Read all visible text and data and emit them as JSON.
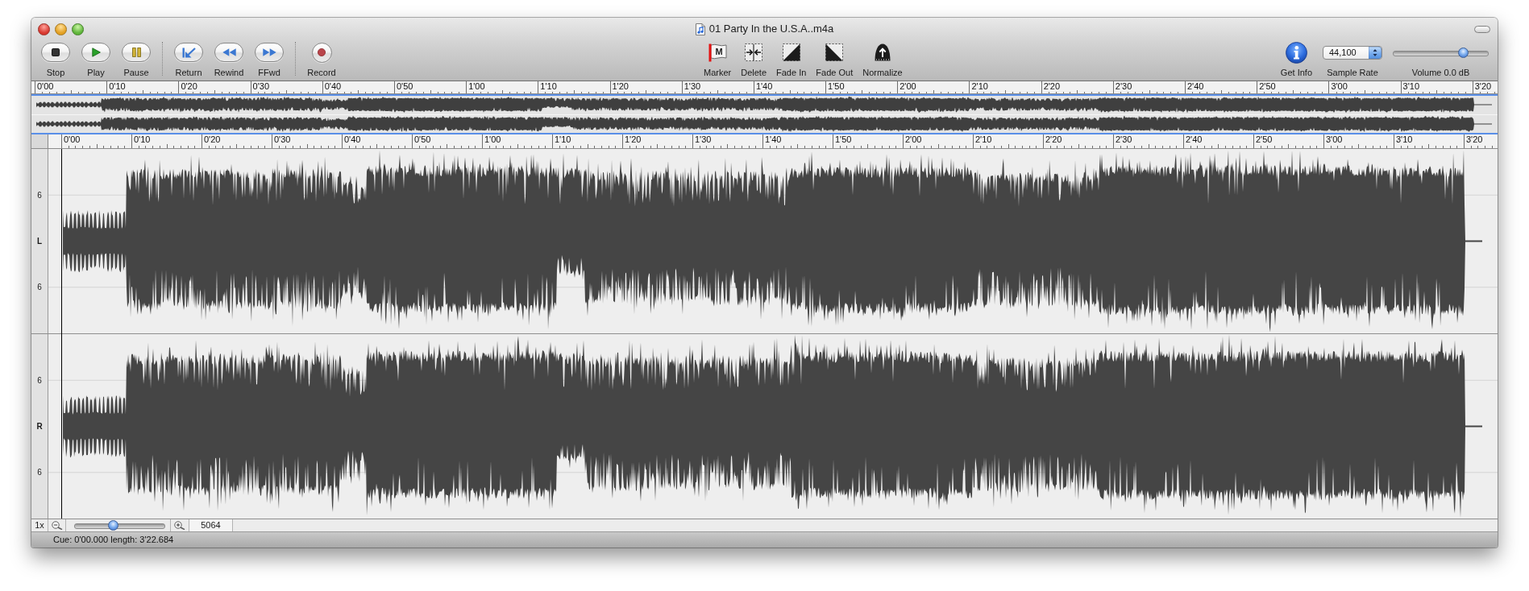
{
  "window": {
    "title": "01 Party In the U.S.A..m4a"
  },
  "toolbar": {
    "button_groups": [
      [
        {
          "kind": "stop",
          "label": "Stop"
        },
        {
          "kind": "play",
          "label": "Play"
        },
        {
          "kind": "pause",
          "label": "Pause"
        }
      ],
      [
        {
          "kind": "return",
          "label": "Return"
        },
        {
          "kind": "rewind",
          "label": "Rewind"
        },
        {
          "kind": "ffwd",
          "label": "FFwd"
        }
      ],
      [
        {
          "kind": "record",
          "label": "Record"
        }
      ]
    ],
    "edit_tools": [
      {
        "kind": "marker",
        "label": "Marker",
        "icon_letter": "M"
      },
      {
        "kind": "delete",
        "label": "Delete"
      },
      {
        "kind": "fade_in",
        "label": "Fade In"
      },
      {
        "kind": "fade_out",
        "label": "Fade Out"
      },
      {
        "kind": "normalize",
        "label": "Normalize"
      }
    ],
    "get_info": {
      "label": "Get Info"
    },
    "sample_rate": {
      "label": "Sample Rate",
      "value": "44,100"
    },
    "volume": {
      "label": "Volume 0.0 dB",
      "level": 0.76
    }
  },
  "overview": {
    "ruler": [
      "0'00",
      "0'10",
      "0'20",
      "0'30",
      "0'40",
      "0'50",
      "1'00",
      "1'10",
      "1'20",
      "1'30",
      "1'40",
      "1'50",
      "2'00",
      "2'10",
      "2'20",
      "2'30",
      "2'40",
      "2'50",
      "3'00",
      "3'10",
      "3'20"
    ]
  },
  "editor": {
    "ruler": [
      "0'00",
      "0'10",
      "0'20",
      "0'30",
      "0'40",
      "0'50",
      "1'00",
      "1'10",
      "1'20",
      "1'30",
      "1'40",
      "1'50",
      "2'00",
      "2'10",
      "2'20",
      "2'30",
      "2'40",
      "2'50",
      "3'00",
      "3'10",
      "3'20"
    ],
    "channels": [
      {
        "name": "L",
        "scale": [
          "6",
          "6"
        ]
      },
      {
        "name": "R",
        "scale": [
          "6",
          "6"
        ]
      }
    ]
  },
  "zoom_bar": {
    "factor": "1x",
    "level": 0.42,
    "value": "5064"
  },
  "status_bar": {
    "text": "Cue: 0'00.000 length: 3'22.684"
  }
}
